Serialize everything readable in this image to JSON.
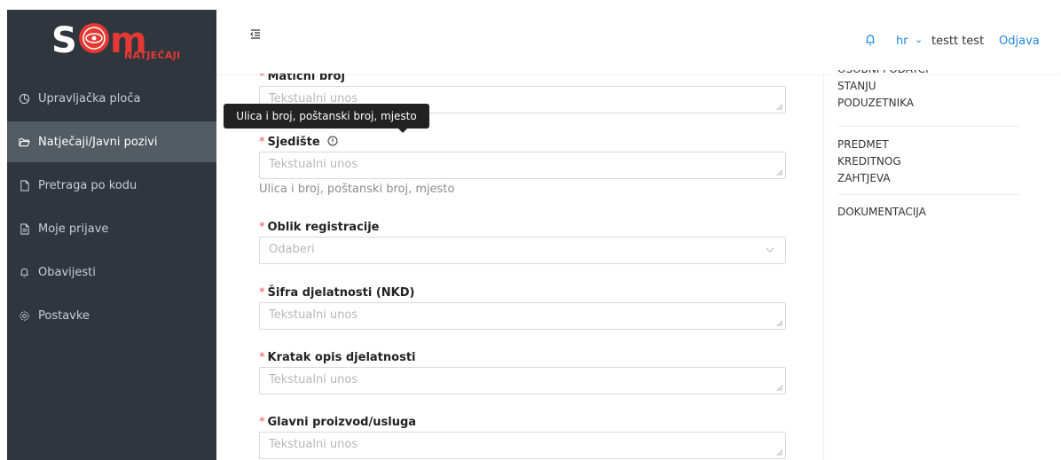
{
  "app": {
    "logo_text": "SOM",
    "logo_sub": "NATJEČAJI"
  },
  "sidebar": {
    "items": [
      {
        "label": "Upravljačka ploča",
        "icon": "dashboard-icon"
      },
      {
        "label": "Natječaji/Javni pozivi",
        "icon": "folder-open-icon",
        "active": true
      },
      {
        "label": "Pretraga po kodu",
        "icon": "file-icon"
      },
      {
        "label": "Moje prijave",
        "icon": "file-text-icon"
      },
      {
        "label": "Obavijesti",
        "icon": "bell-icon"
      },
      {
        "label": "Postavke",
        "icon": "gear-icon"
      }
    ]
  },
  "header": {
    "language": "hr",
    "user_name": "testt test",
    "logout_label": "Odjava"
  },
  "form": {
    "maticni_broj": {
      "label": "Matični broj",
      "placeholder": "Tekstualni unos"
    },
    "sjediste": {
      "label": "Sjedište",
      "placeholder": "Tekstualni unos",
      "hint": "Ulica i broj, poštanski broj, mjesto"
    },
    "oblik_registracije": {
      "label": "Oblik registracije",
      "placeholder": "Odaberi"
    },
    "sifra_djelatnosti": {
      "label": "Šifra djelatnosti (NKD)",
      "placeholder": "Tekstualni unos"
    },
    "kratak_opis": {
      "label": "Kratak opis djelatnosti",
      "placeholder": "Tekstualni unos"
    },
    "glavni_proizvod": {
      "label": "Glavni proizvod/usluga",
      "placeholder": "Tekstualni unos"
    },
    "required_mark": "*"
  },
  "tooltip": {
    "text": "Ulica i broj, poštanski broj, mjesto"
  },
  "right_menu": {
    "items": [
      {
        "lines": [
          "OSOBNI PODATCI",
          "STANJU",
          "PODUZETNIKA"
        ]
      },
      {
        "lines": [
          "PREDMET",
          "KREDITNOG",
          "ZAHTJEVA"
        ]
      },
      {
        "lines": [
          "DOKUMENTACIJA"
        ]
      }
    ]
  },
  "colors": {
    "sidebar_bg": "#2f363d",
    "sidebar_active": "#535b63",
    "accent_blue": "#1e88e5",
    "required_red": "#ef5350",
    "logo_red": "#e53935"
  }
}
